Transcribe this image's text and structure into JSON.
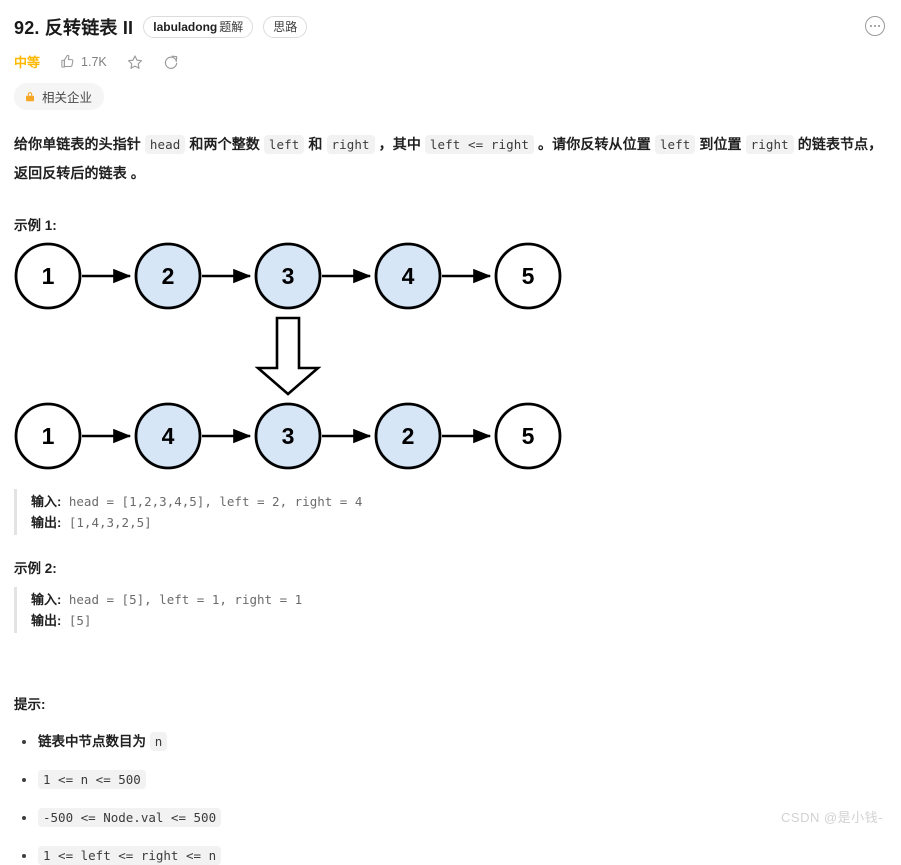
{
  "header": {
    "problem_title": "92. 反转链表 II",
    "tags": [
      {
        "brand": "labuladong",
        "label": "题解"
      },
      {
        "brand": "",
        "label": "思路"
      }
    ],
    "more_icon": "ellipsis-icon"
  },
  "meta": {
    "difficulty": "中等",
    "likes_icon": "thumbs-up-icon",
    "likes": "1.7K",
    "favorite_icon": "star-icon",
    "share_icon": "share-icon"
  },
  "company": {
    "lock_icon": "lock-icon",
    "label": "相关企业"
  },
  "description": {
    "part1": "给你单链表的头指针 ",
    "code_head": "head",
    "part2": " 和两个整数 ",
    "code_left": "left",
    "part3": " 和 ",
    "code_right": "right",
    "part4": " ，其中 ",
    "code_cond": "left <= right",
    "part5": " 。请你反转从位置 ",
    "code_left2": "left",
    "part6": " 到位置 ",
    "code_right2": "right",
    "part7": " 的链表节点，返回反转后的链表 。"
  },
  "example1": {
    "heading": "示例 1:",
    "input_label": "输入:",
    "input_value": " head = [1,2,3,4,5], left = 2, right = 4",
    "output_label": "输出:",
    "output_value": " [1,4,3,2,5]"
  },
  "example2": {
    "heading": "示例 2:",
    "input_label": "输入:",
    "input_value": " head = [5], left = 1, right = 1",
    "output_label": "输出:",
    "output_value": " [5]"
  },
  "hints": {
    "heading": "提示:",
    "items": [
      {
        "text": "链表中节点数目为 ",
        "code": "n",
        "code_only": false
      },
      {
        "text": "",
        "code": "1 <= n <= 500",
        "code_only": true
      },
      {
        "text": "",
        "code": "-500 <= Node.val <= 500",
        "code_only": true
      },
      {
        "text": "",
        "code": "1 <= left <= right <= n",
        "code_only": true
      }
    ]
  },
  "diagram": {
    "title": "linked-list-reversal-illustration",
    "arrow_glyph": "block-down-arrow",
    "node_fill_plain": "#ffffff",
    "node_fill_highlight": "#d6e6f7",
    "node_stroke": "#000000",
    "before": {
      "label": "before-reversal",
      "nodes": [
        {
          "value": "1",
          "highlight": false
        },
        {
          "value": "2",
          "highlight": true
        },
        {
          "value": "3",
          "highlight": true
        },
        {
          "value": "4",
          "highlight": true
        },
        {
          "value": "5",
          "highlight": false
        }
      ]
    },
    "after": {
      "label": "after-reversal",
      "nodes": [
        {
          "value": "1",
          "highlight": false
        },
        {
          "value": "4",
          "highlight": true
        },
        {
          "value": "3",
          "highlight": true
        },
        {
          "value": "2",
          "highlight": true
        },
        {
          "value": "5",
          "highlight": false
        }
      ]
    }
  },
  "watermark": {
    "text": "CSDN @是小钱-"
  }
}
